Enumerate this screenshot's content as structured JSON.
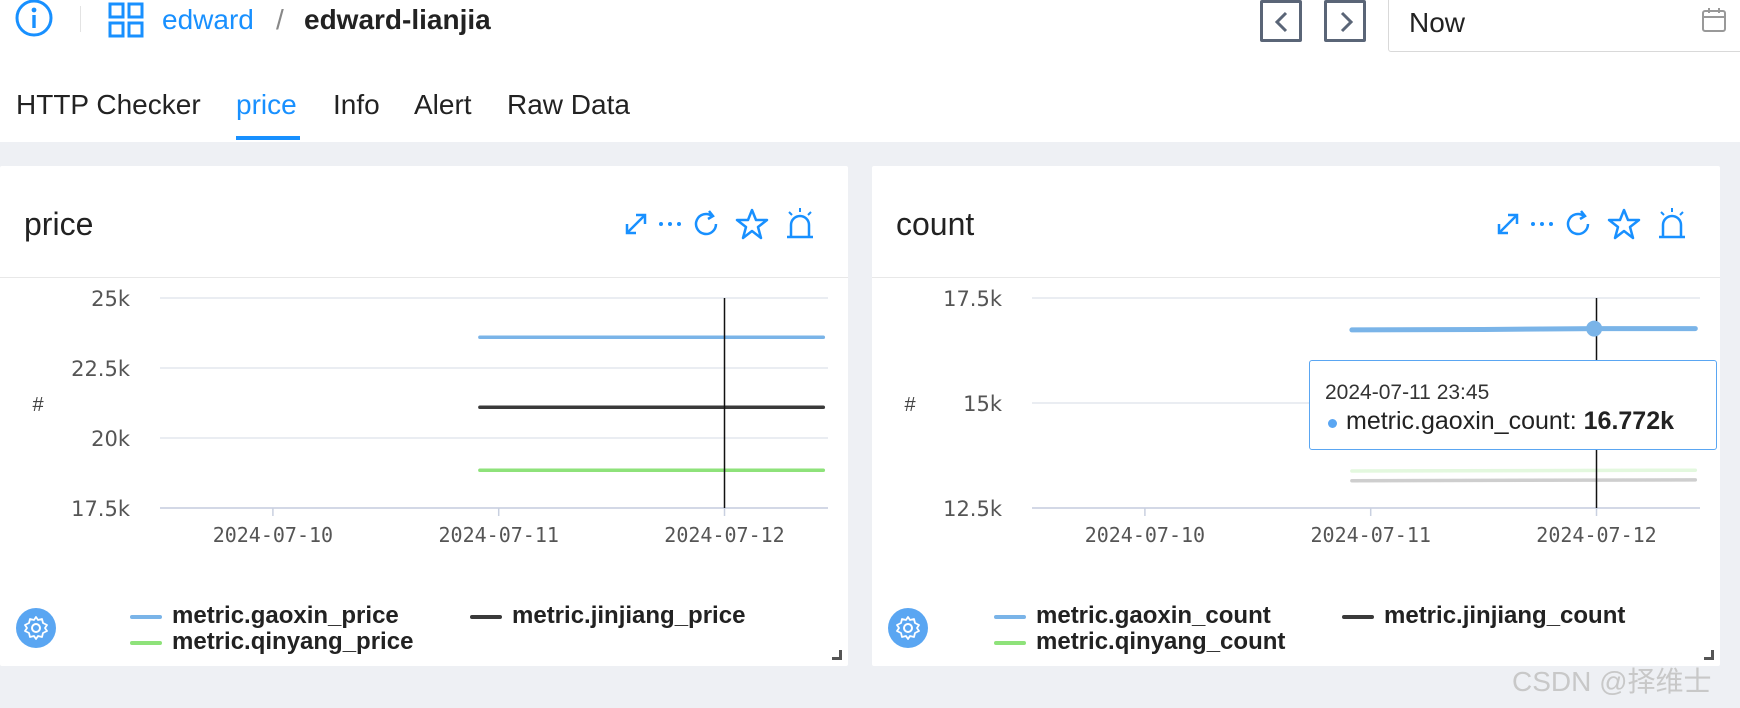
{
  "header": {
    "breadcrumb_root": "edward",
    "breadcrumb_sep": "/",
    "breadcrumb_leaf": "edward-lianjia",
    "time_value": "Now"
  },
  "tabs": [
    {
      "label": "HTTP Checker",
      "active": false
    },
    {
      "label": "price",
      "active": true
    },
    {
      "label": "Info",
      "active": false
    },
    {
      "label": "Alert",
      "active": false
    },
    {
      "label": "Raw Data",
      "active": false
    }
  ],
  "colors": {
    "accent": "#1890ff",
    "series_blue": "#7ab4e8",
    "series_black": "#3a3a3a",
    "series_green": "#8ee27a"
  },
  "panels": [
    {
      "title": "price",
      "legend": [
        {
          "name": "metric.gaoxin_price",
          "color": "#7ab4e8"
        },
        {
          "name": "metric.jinjiang_price",
          "color": "#3a3a3a"
        },
        {
          "name": "metric.qinyang_price",
          "color": "#8ee27a"
        }
      ]
    },
    {
      "title": "count",
      "legend": [
        {
          "name": "metric.gaoxin_count",
          "color": "#7ab4e8"
        },
        {
          "name": "metric.jinjiang_count",
          "color": "#3a3a3a"
        },
        {
          "name": "metric.qinyang_count",
          "color": "#8ee27a"
        }
      ],
      "tooltip": {
        "time": "2024-07-11 23:45",
        "series": "metric.gaoxin_count:",
        "value": "16.772k"
      }
    }
  ],
  "chart_data": [
    {
      "type": "line",
      "title": "price",
      "ylabel": "#",
      "yticks": [
        "25k",
        "22.5k",
        "20k",
        "17.5k"
      ],
      "ylim": [
        17500,
        25000
      ],
      "xticks": [
        "2024-07-10",
        "2024-07-11",
        "2024-07-12"
      ],
      "x_range": [
        "2024-07-09 12:00",
        "2024-07-12 11:00"
      ],
      "cursor_x": "2024-07-12 00:00",
      "series": [
        {
          "name": "metric.gaoxin_price",
          "color": "#7ab4e8",
          "x": [
            "2024-07-10 22:00",
            "2024-07-12 10:30"
          ],
          "values": [
            23600,
            23600
          ]
        },
        {
          "name": "metric.jinjiang_price",
          "color": "#3a3a3a",
          "x": [
            "2024-07-10 22:00",
            "2024-07-12 10:30"
          ],
          "values": [
            21100,
            21100
          ]
        },
        {
          "name": "metric.qinyang_price",
          "color": "#8ee27a",
          "x": [
            "2024-07-10 22:00",
            "2024-07-12 10:30"
          ],
          "values": [
            18850,
            18850
          ]
        }
      ]
    },
    {
      "type": "line",
      "title": "count",
      "ylabel": "#",
      "yticks": [
        "17.5k",
        "15k",
        "12.5k"
      ],
      "ylim": [
        12500,
        17500
      ],
      "xticks": [
        "2024-07-10",
        "2024-07-11",
        "2024-07-12"
      ],
      "x_range": [
        "2024-07-09 12:00",
        "2024-07-12 11:00"
      ],
      "cursor_x": "2024-07-12 00:00",
      "series": [
        {
          "name": "metric.gaoxin_count",
          "color": "#7ab4e8",
          "x": [
            "2024-07-10 22:00",
            "2024-07-11 12:00",
            "2024-07-11 23:45",
            "2024-07-12 10:30"
          ],
          "values": [
            16740,
            16750,
            16772,
            16772
          ]
        },
        {
          "name": "metric.jinjiang_count",
          "color": "#3a3a3a",
          "faded": true,
          "x": [
            "2024-07-10 22:00",
            "2024-07-12 10:30"
          ],
          "values": [
            13150,
            13170
          ]
        },
        {
          "name": "metric.qinyang_count",
          "color": "#8ee27a",
          "faded": true,
          "x": [
            "2024-07-10 22:00",
            "2024-07-12 10:30"
          ],
          "values": [
            13380,
            13400
          ]
        }
      ]
    }
  ],
  "watermark": "CSDN @择维士"
}
